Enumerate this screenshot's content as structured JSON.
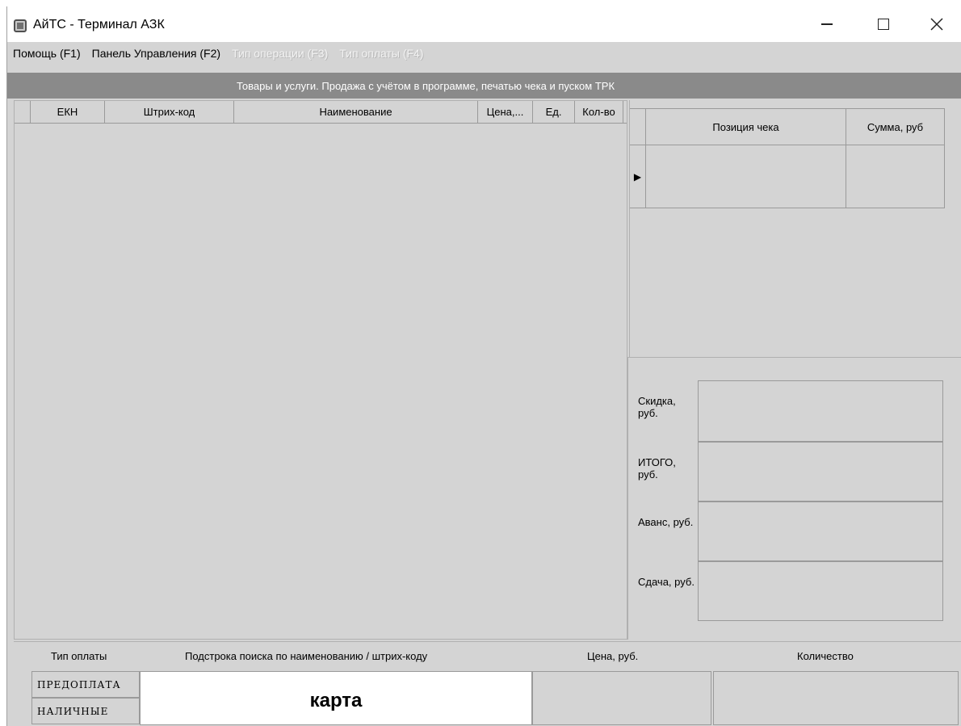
{
  "window": {
    "title": "АйТС - Терминал АЗК",
    "controls": {
      "minimize": "minimize-icon",
      "maximize": "maximize-icon",
      "close": "close-icon"
    }
  },
  "menu": {
    "items": [
      {
        "label": "Помощь (F1)",
        "enabled": true
      },
      {
        "label": "Панель Управления (F2)",
        "enabled": true
      },
      {
        "label": "Тип операции (F3)",
        "enabled": false
      },
      {
        "label": "Тип оплаты (F4)",
        "enabled": false
      }
    ]
  },
  "banner": {
    "text": "Товары и услуги. Продажа с учётом в программе, печатью чека и пуском ТРК"
  },
  "goods_table": {
    "columns": [
      "ЕКН",
      "Штрих-код",
      "Наименование",
      "Цена,...",
      "Ед.",
      "Кол-во"
    ],
    "rows": []
  },
  "receipt_table": {
    "columns": [
      "Позиция чека",
      "Сумма, руб"
    ],
    "rows": [
      {
        "position": "",
        "sum": ""
      }
    ],
    "current_row_indicator": "▶"
  },
  "totals": {
    "discount_label": "Скидка, руб.",
    "total_label": "ИТОГО, руб.",
    "advance_label": "Аванс, руб.",
    "change_label": "Сдача, руб.",
    "discount_value": "",
    "total_value": "",
    "advance_value": "",
    "change_value": ""
  },
  "bottom": {
    "payment_type_label": "Тип оплаты",
    "search_label": "Подстрока поиска по наименованию / штрих-коду",
    "price_label": "Цена, руб.",
    "quantity_label": "Количество",
    "payment_options": [
      "ПРЕДОПЛАТА",
      "НАЛИЧНЫЕ"
    ],
    "search_value": "карта",
    "price_value": "",
    "quantity_value": ""
  },
  "colors": {
    "window_bg": "#d4d4d4",
    "banner_bg": "#8a8a8a",
    "banner_text": "#ffffff",
    "disabled_menu_text": "#f2f2f2"
  }
}
